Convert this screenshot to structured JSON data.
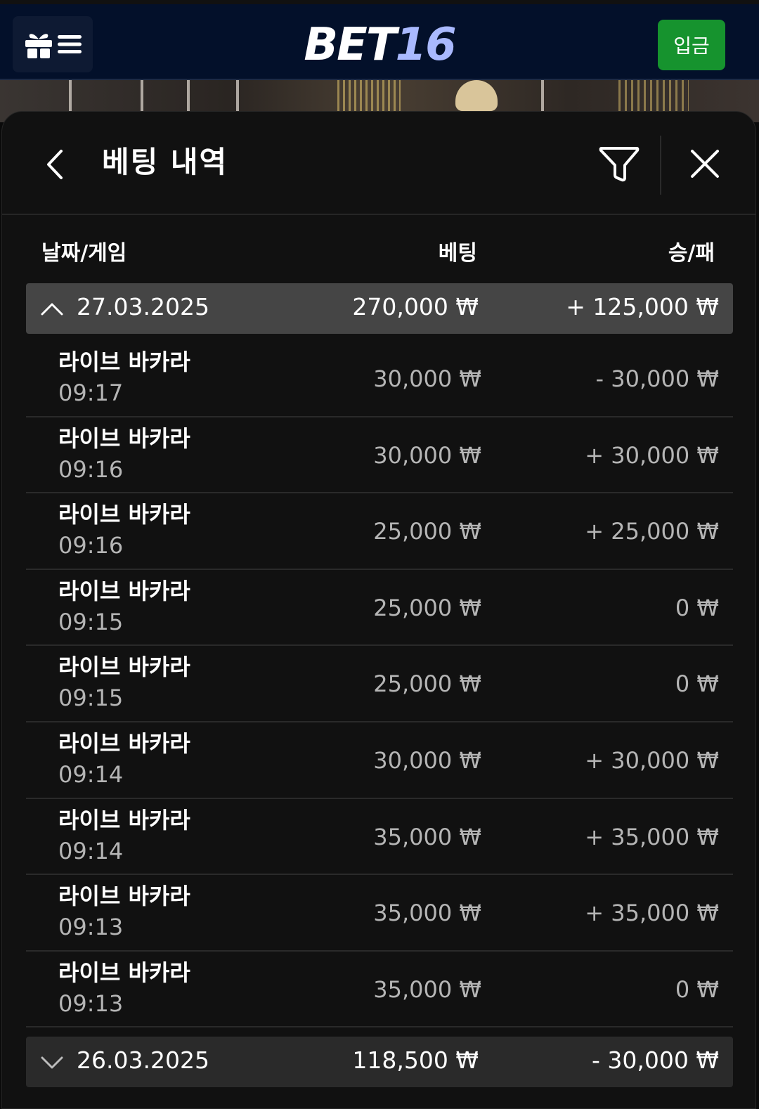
{
  "header": {
    "logo_prefix": "BET",
    "logo_suffix": "16",
    "deposit_label": "입금"
  },
  "panel": {
    "title": "베팅 내역"
  },
  "columns": {
    "date_game": "날짜/게임",
    "bet": "베팅",
    "win_loss": "승/패"
  },
  "groups": [
    {
      "date": "27.03.2025",
      "bet": "270,000 ₩",
      "result": "+ 125,000 ₩",
      "expanded": true
    },
    {
      "date": "26.03.2025",
      "bet": "118,500 ₩",
      "result": "- 30,000 ₩",
      "expanded": false
    }
  ],
  "rows": [
    {
      "game": "라이브 바카라",
      "time": "09:17",
      "bet": "30,000 ₩",
      "result": "- 30,000 ₩"
    },
    {
      "game": "라이브 바카라",
      "time": "09:16",
      "bet": "30,000 ₩",
      "result": "+ 30,000 ₩"
    },
    {
      "game": "라이브 바카라",
      "time": "09:16",
      "bet": "25,000 ₩",
      "result": "+ 25,000 ₩"
    },
    {
      "game": "라이브 바카라",
      "time": "09:15",
      "bet": "25,000 ₩",
      "result": "0 ₩"
    },
    {
      "game": "라이브 바카라",
      "time": "09:15",
      "bet": "25,000 ₩",
      "result": "0 ₩"
    },
    {
      "game": "라이브 바카라",
      "time": "09:14",
      "bet": "30,000 ₩",
      "result": "+ 30,000 ₩"
    },
    {
      "game": "라이브 바카라",
      "time": "09:14",
      "bet": "35,000 ₩",
      "result": "+ 35,000 ₩"
    },
    {
      "game": "라이브 바카라",
      "time": "09:13",
      "bet": "35,000 ₩",
      "result": "+ 35,000 ₩"
    },
    {
      "game": "라이브 바카라",
      "time": "09:13",
      "bet": "35,000 ₩",
      "result": "0 ₩"
    }
  ],
  "icons": {
    "menu": "gift-menu-icon",
    "back": "chevron-left-icon",
    "filter": "filter-icon",
    "close": "close-icon",
    "collapse": "chevron-up-icon",
    "expand": "chevron-down-icon"
  },
  "colors": {
    "topbar": "#03102a",
    "deposit": "#16932e",
    "logo_accent": "#a9b9ff",
    "panel": "#111111",
    "group_open": "#454545",
    "group_closed": "#2a2a2a"
  }
}
